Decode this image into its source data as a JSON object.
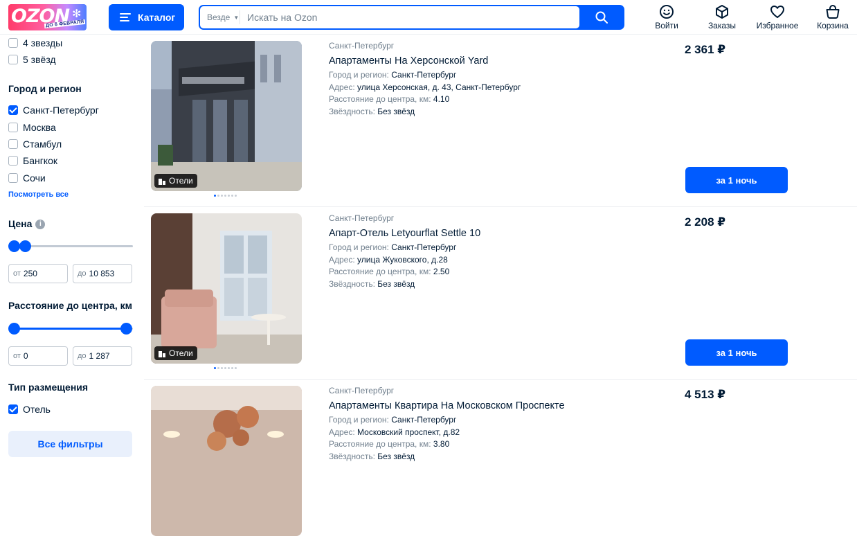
{
  "header": {
    "logo_text": "OZON",
    "logo_subtext": "ДО 6 ФЕВРАЛЯ",
    "catalog_label": "Каталог",
    "search": {
      "scope": "Везде",
      "placeholder": "Искать на Ozon",
      "value": ""
    },
    "nav": [
      {
        "label": "Войти",
        "icon": "smile-icon"
      },
      {
        "label": "Заказы",
        "icon": "box-icon"
      },
      {
        "label": "Избранное",
        "icon": "heart-icon"
      },
      {
        "label": "Корзина",
        "icon": "bag-icon"
      }
    ]
  },
  "filters": {
    "stars": [
      {
        "label": "4 звезды",
        "checked": false
      },
      {
        "label": "5 звёзд",
        "checked": false
      }
    ],
    "city": {
      "title": "Город и регион",
      "options": [
        {
          "label": "Санкт-Петербург",
          "checked": true
        },
        {
          "label": "Москва",
          "checked": false
        },
        {
          "label": "Стамбул",
          "checked": false
        },
        {
          "label": "Бангкок",
          "checked": false
        },
        {
          "label": "Сочи",
          "checked": false
        }
      ],
      "see_all": "Посмотреть все"
    },
    "price": {
      "title": "Цена",
      "from_prefix": "от",
      "from": "250",
      "to_prefix": "до",
      "to": "10 853"
    },
    "distance": {
      "title": "Расстояние до центра, км",
      "from_prefix": "от",
      "from": "0",
      "to_prefix": "до",
      "to": "1 287"
    },
    "accommodation": {
      "title": "Тип размещения",
      "options": [
        {
          "label": "Отель",
          "checked": true
        }
      ]
    },
    "all_filters": "Все фильтры"
  },
  "listings": [
    {
      "city": "Санкт-Петербург",
      "title": "Апартаменты На Херсонской Yard",
      "region_label": "Город и регион:",
      "region": "Санкт-Петербург",
      "address_label": "Адрес:",
      "address": "улица Херсонская, д. 43, Санкт-Петербург",
      "distance_label": "Расстояние до центра, км:",
      "distance": "4.10",
      "stars_label": "Звёздность:",
      "stars": "Без звёзд",
      "price": "2 361 ₽",
      "badge": "Отели",
      "button": "за 1 ночь"
    },
    {
      "city": "Санкт-Петербург",
      "title": "Апарт-Отель Letyourflat Settle 10",
      "region_label": "Город и регион:",
      "region": "Санкт-Петербург",
      "address_label": "Адрес:",
      "address": "улица Жуковского, д.28",
      "distance_label": "Расстояние до центра, км:",
      "distance": "2.50",
      "stars_label": "Звёздность:",
      "stars": "Без звёзд",
      "price": "2 208 ₽",
      "badge": "Отели",
      "button": "за 1 ночь"
    },
    {
      "city": "Санкт-Петербург",
      "title": "Апартаменты Квартира На Московском Проспекте",
      "region_label": "Город и регион:",
      "region": "Санкт-Петербург",
      "address_label": "Адрес:",
      "address": "Московский проспект, д.82",
      "distance_label": "Расстояние до центра, км:",
      "distance": "3.80",
      "stars_label": "Звёздность:",
      "stars": "Без звёзд",
      "price": "4 513 ₽"
    }
  ],
  "colors": {
    "accent": "#005bff",
    "text": "#001a34",
    "muted": "#707f8d"
  }
}
